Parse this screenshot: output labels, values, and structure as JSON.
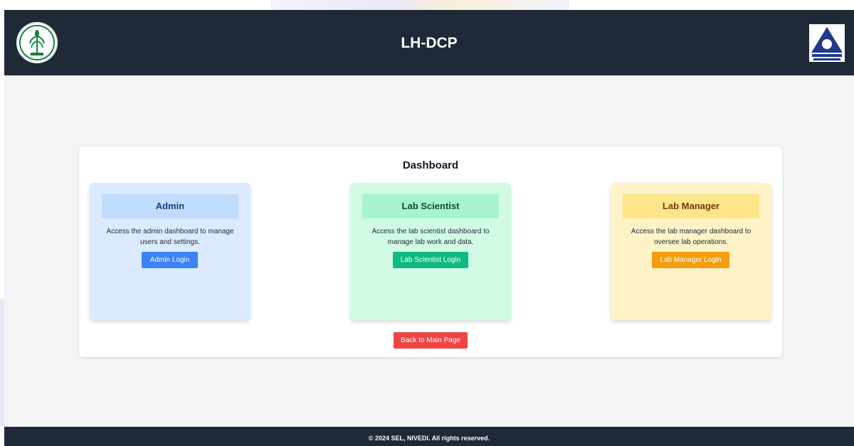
{
  "header": {
    "title": "LH-DCP",
    "left_logo": "icar-wheat-logo",
    "right_logo": "icar-nivedi-logo"
  },
  "dashboard": {
    "title": "Dashboard",
    "cards": [
      {
        "title": "Admin",
        "description": "Access the admin dashboard to manage users and settings.",
        "button_label": "Admin Login",
        "color": "#3b82f6"
      },
      {
        "title": "Lab Scientist",
        "description": "Access the lab scientist dashboard to manage lab work and data.",
        "button_label": "Lab Scientist Login",
        "color": "#10b981"
      },
      {
        "title": "Lab Manager",
        "description": "Access the lab manager dashboard to oversee lab operations.",
        "button_label": "Lab Manager Login",
        "color": "#f59e0b"
      }
    ],
    "back_button_label": "Back to Main Page",
    "back_button_color": "#ef4444"
  },
  "footer": {
    "text": "© 2024 SEL, NIVEDI. All rights reserved."
  }
}
